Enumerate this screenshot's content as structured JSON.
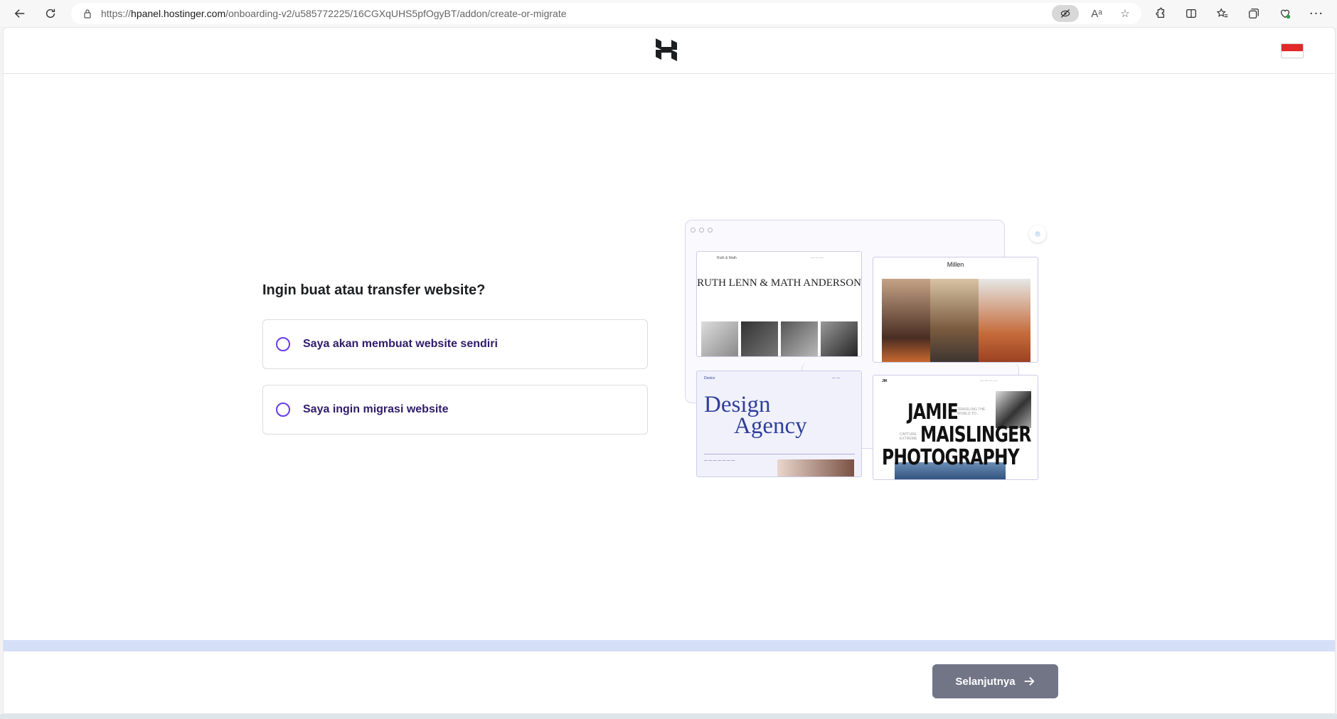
{
  "browser": {
    "url_prefix": "https://",
    "url_host": "hpanel.hostinger.com",
    "url_path": "/onboarding-v2/u585772225/16CGXqUHS5pfOgyBT/addon/create-or-migrate"
  },
  "header": {
    "logo_icon": "hostinger-logo-icon",
    "language_flag": "indonesia-flag-icon"
  },
  "main": {
    "question": "Ingin buat atau transfer website?",
    "options": [
      {
        "label": "Saya akan membuat website sendiri",
        "selected": false
      },
      {
        "label": "Saya ingin migrasi website",
        "selected": false
      }
    ]
  },
  "illustration": {
    "card1_brand": "Ruth & Math",
    "card1_title": "RUTH LENN & MATH ANDERSON",
    "card2_title": "Millen",
    "card3_brand": "Desico",
    "card3_title_line1": "Design",
    "card3_title_line2": "Agency",
    "card4_line1": "JAMIE",
    "card4_line2": "MAISLINGER",
    "card4_line3": "PHOTOGRAPHY",
    "card4_tag1": "TRAVELING THE WORLD TO...",
    "card4_tag2": "CAPTURE EXTREME"
  },
  "footer": {
    "next_label": "Selanjutnya",
    "colors": {
      "button": "#727586",
      "progress_track": "#d5dff8",
      "accent": "#673de6"
    }
  }
}
